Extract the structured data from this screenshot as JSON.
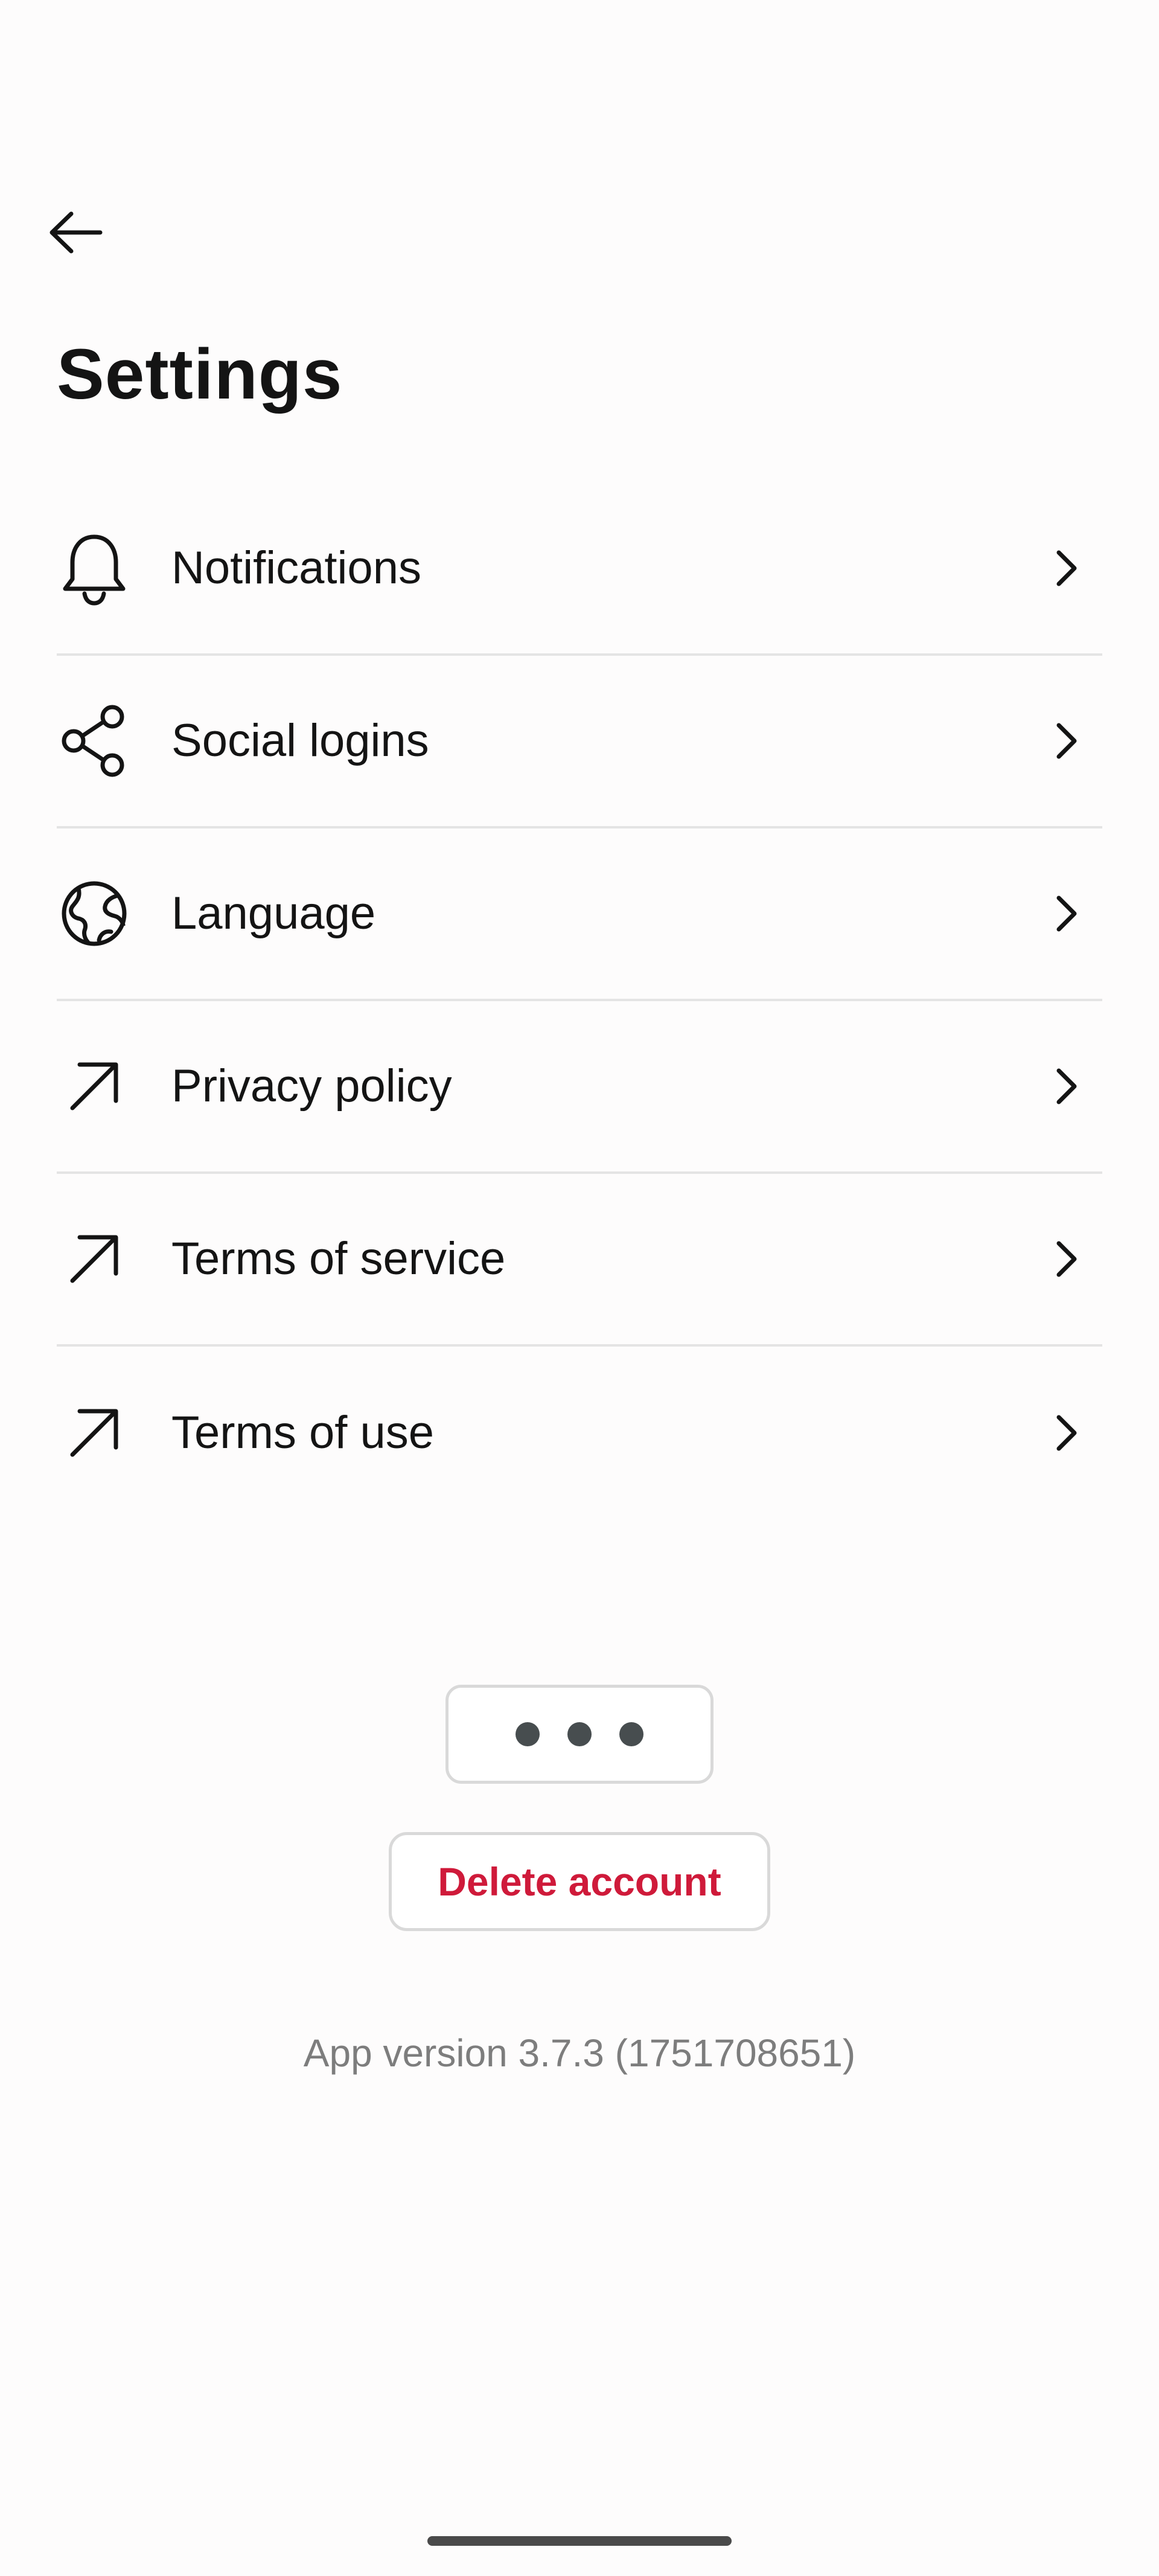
{
  "header": {
    "back_icon": "arrow-left-icon",
    "title": "Settings"
  },
  "settings": {
    "items": [
      {
        "label": "Notifications",
        "icon": "bell-icon"
      },
      {
        "label": "Social logins",
        "icon": "share-icon"
      },
      {
        "label": "Language",
        "icon": "globe-icon"
      },
      {
        "label": "Privacy policy",
        "icon": "arrow-up-right-icon"
      },
      {
        "label": "Terms of service",
        "icon": "arrow-up-right-icon"
      },
      {
        "label": "Terms of use",
        "icon": "arrow-up-right-icon"
      }
    ],
    "chevron_icon": "chevron-right-icon"
  },
  "actions": {
    "more_icon": "more-horizontal-icon",
    "delete_label": "Delete account"
  },
  "footer": {
    "app_version": "App version 3.7.3 (1751708651)"
  },
  "colors": {
    "background": "#fdfcfc",
    "text": "#141414",
    "divider": "#e4e4e4",
    "danger": "#cf1a3a",
    "muted": "#7d7d7d",
    "border": "#d9d9d9"
  }
}
